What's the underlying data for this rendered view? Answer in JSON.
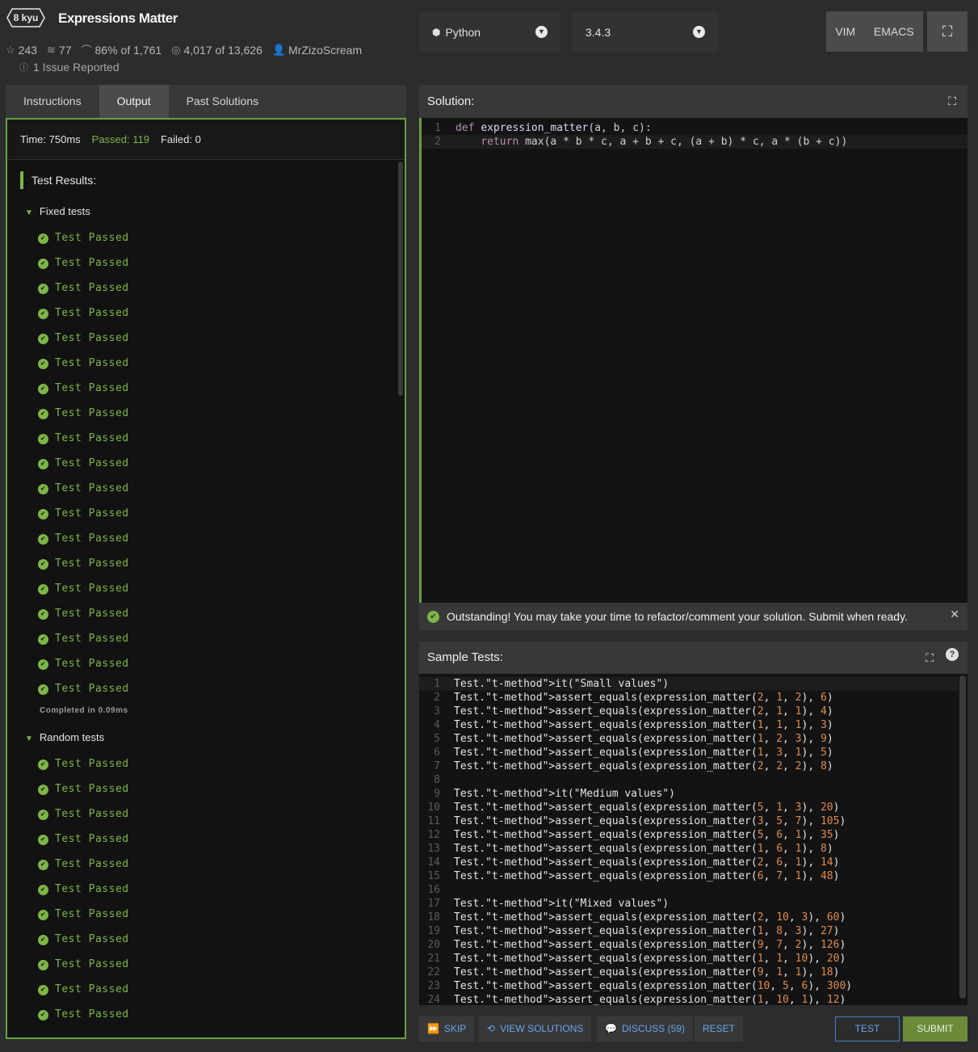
{
  "kata": {
    "rank": "8 kyu",
    "title": "Expressions Matter",
    "stars": "243",
    "collections": "77",
    "satisfaction": "86%",
    "satisfaction_suffix": "of 1,761",
    "completed": "4,017",
    "completed_suffix": "of 13,626",
    "author": "MrZizoScream",
    "issues": "1 Issue Reported"
  },
  "toolbar": {
    "language": "Python",
    "version": "3.4.3",
    "vim": "VIM",
    "emacs": "EMACS"
  },
  "tabs": [
    "Instructions",
    "Output",
    "Past Solutions"
  ],
  "output": {
    "time": "Time: 750ms",
    "passed": "Passed: 119",
    "failed": "Failed: 0",
    "results_title": "Test Results:",
    "fixed_group": "Fixed tests",
    "random_group": "Random tests",
    "pass_label": "Test Passed",
    "completed_in": "Completed in 0.09ms",
    "fixed_count": 19,
    "random_visible_count": 11
  },
  "solution": {
    "title": "Solution:",
    "lines": [
      "def expression_matter(a, b, c):",
      "    return max(a * b * c, a + b + c, (a + b) * c, a * (b + c))"
    ]
  },
  "banner": {
    "message": "Outstanding! You may take your time to refactor/comment your solution. Submit when ready."
  },
  "sample_tests": {
    "title": "Sample Tests:",
    "lines": [
      "Test.it(\"Small values\")",
      "Test.assert_equals(expression_matter(2, 1, 2), 6)",
      "Test.assert_equals(expression_matter(2, 1, 1), 4)",
      "Test.assert_equals(expression_matter(1, 1, 1), 3)",
      "Test.assert_equals(expression_matter(1, 2, 3), 9)",
      "Test.assert_equals(expression_matter(1, 3, 1), 5)",
      "Test.assert_equals(expression_matter(2, 2, 2), 8)",
      "",
      "Test.it(\"Medium values\")",
      "Test.assert_equals(expression_matter(5, 1, 3), 20)",
      "Test.assert_equals(expression_matter(3, 5, 7), 105)",
      "Test.assert_equals(expression_matter(5, 6, 1), 35)",
      "Test.assert_equals(expression_matter(1, 6, 1), 8)",
      "Test.assert_equals(expression_matter(2, 6, 1), 14)",
      "Test.assert_equals(expression_matter(6, 7, 1), 48)",
      "",
      "Test.it(\"Mixed values\")",
      "Test.assert_equals(expression_matter(2, 10, 3), 60)",
      "Test.assert_equals(expression_matter(1, 8, 3), 27)",
      "Test.assert_equals(expression_matter(9, 7, 2), 126)",
      "Test.assert_equals(expression_matter(1, 1, 10), 20)",
      "Test.assert_equals(expression_matter(9, 1, 1), 18)",
      "Test.assert_equals(expression_matter(10, 5, 6), 300)",
      "Test.assert_equals(expression_matter(1, 10, 1), 12)"
    ]
  },
  "buttons": {
    "skip": "SKIP",
    "view_solutions": "VIEW SOLUTIONS",
    "discuss": "DISCUSS (59)",
    "reset": "RESET",
    "test": "TEST",
    "submit": "SUBMIT"
  }
}
